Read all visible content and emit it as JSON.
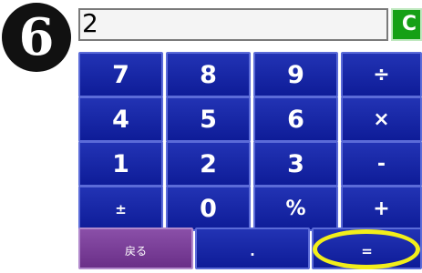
{
  "step_badge": "6",
  "display": {
    "value": "2"
  },
  "clear_label": "C",
  "keys": [
    [
      "7",
      "8",
      "9",
      "÷"
    ],
    [
      "4",
      "5",
      "6",
      "×"
    ],
    [
      "1",
      "2",
      "3",
      "-"
    ],
    [
      "±",
      "0",
      "%",
      "+"
    ]
  ],
  "bottom": {
    "back_label": "戻る",
    "dot_label": ".",
    "equals_label": "="
  },
  "colors": {
    "key_blue": "#1a2aa8",
    "key_border": "#5b6bd8",
    "back_purple": "#7a3f98",
    "clear_green": "#16a016",
    "highlight_yellow": "#f2ee1a"
  }
}
